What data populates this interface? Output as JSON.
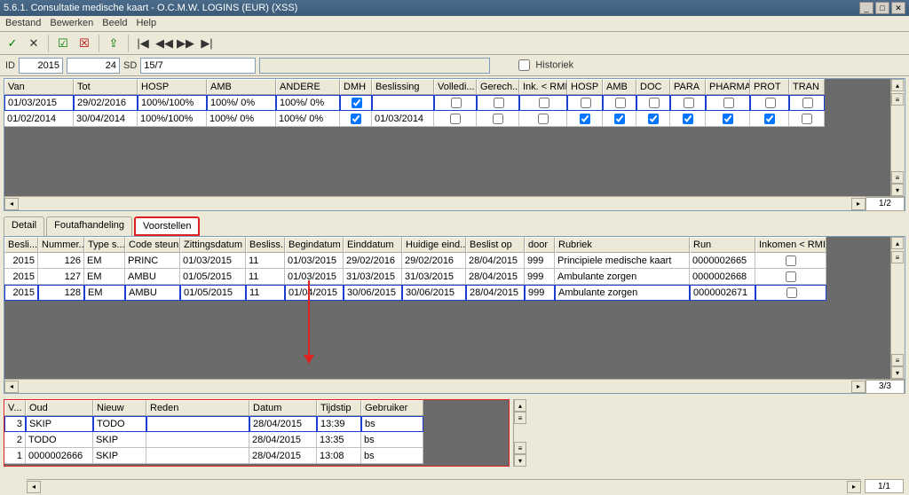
{
  "window": {
    "title": "5.6.1. Consultatie medische kaart - O.C.M.W. LOGINS (EUR) (XSS)",
    "menu": [
      "Bestand",
      "Bewerken",
      "Beeld",
      "Help"
    ]
  },
  "toolbar": {
    "ok": "✓",
    "cancel": "✕",
    "checkbox_on": "☑",
    "checkbox_off": "☒",
    "export": "⇪",
    "first": "|◀",
    "prev": "◀◀",
    "next": "▶▶",
    "last": "▶|"
  },
  "idrow": {
    "id_label": "ID",
    "id_year": "2015",
    "id_num": "24",
    "sd_label": "SD",
    "sd_val": "15/7",
    "hist_label": "Historiek"
  },
  "grid1": {
    "headers": [
      "Van",
      "Tot",
      "HOSP",
      "AMB",
      "ANDERE",
      "DMH",
      "Beslissing",
      "Volledi...",
      "Gerech...",
      "Ink. < RMI",
      "HOSP",
      "AMB",
      "DOC",
      "PARA",
      "PHARMA",
      "PROT",
      "TRAN"
    ],
    "rows": [
      {
        "van": "01/03/2015",
        "tot": "29/02/2016",
        "hosp": "100%/100%",
        "amb": "100%/ 0%",
        "and": "100%/ 0%",
        "dmh": true,
        "bes": "",
        "v": false,
        "g": false,
        "ink": false,
        "h2": false,
        "a2": false,
        "d": false,
        "pa": false,
        "ph": false,
        "pr": false,
        "tr": false,
        "sel": true
      },
      {
        "van": "01/02/2014",
        "tot": "30/04/2014",
        "hosp": "100%/100%",
        "amb": "100%/ 0%",
        "and": "100%/ 0%",
        "dmh": true,
        "bes": "01/03/2014",
        "v": false,
        "g": false,
        "ink": false,
        "h2": true,
        "a2": true,
        "d": true,
        "pa": true,
        "ph": true,
        "pr": true,
        "tr": false
      }
    ],
    "page": "1/2"
  },
  "tabs": {
    "detail": "Detail",
    "fout": "Foutafhandeling",
    "voor": "Voorstellen"
  },
  "grid2": {
    "headers": [
      "Besli...",
      "Nummer...",
      "Type s...",
      "Code steun",
      "Zittingsdatum",
      "Besliss...",
      "Begindatum",
      "Einddatum",
      "Huidige eind...",
      "Beslist op",
      "door",
      "Rubriek",
      "Run",
      "Inkomen < RMI"
    ],
    "rows": [
      {
        "b": "2015",
        "n": "126",
        "t": "EM",
        "c": "PRINC",
        "z": "01/03/2015",
        "bs": "11",
        "bg": "01/03/2015",
        "e": "29/02/2016",
        "h": "29/02/2016",
        "bo": "28/04/2015",
        "d": "999",
        "r": "Principiele medische kaart",
        "run": "0000002665",
        "ink": false
      },
      {
        "b": "2015",
        "n": "127",
        "t": "EM",
        "c": "AMBU",
        "z": "01/05/2015",
        "bs": "11",
        "bg": "01/03/2015",
        "e": "31/03/2015",
        "h": "31/03/2015",
        "bo": "28/04/2015",
        "d": "999",
        "r": "Ambulante zorgen",
        "run": "0000002668",
        "ink": false
      },
      {
        "b": "2015",
        "n": "128",
        "t": "EM",
        "c": "AMBU",
        "z": "01/05/2015",
        "bs": "11",
        "bg": "01/04/2015",
        "e": "30/06/2015",
        "h": "30/06/2015",
        "bo": "28/04/2015",
        "d": "999",
        "r": "Ambulante zorgen",
        "run": "0000002671",
        "ink": false,
        "sel": true
      }
    ],
    "page": "3/3"
  },
  "grid3": {
    "headers": [
      "V...",
      "Oud",
      "Nieuw",
      "Reden",
      "Datum",
      "Tijdstip",
      "Gebruiker"
    ],
    "rows": [
      {
        "v": "3",
        "o": "SKIP",
        "n": "TODO",
        "r": "",
        "d": "28/04/2015",
        "t": "13:39",
        "g": "bs",
        "sel": true
      },
      {
        "v": "2",
        "o": "TODO",
        "n": "SKIP",
        "r": "",
        "d": "28/04/2015",
        "t": "13:35",
        "g": "bs"
      },
      {
        "v": "1",
        "o": "0000002666",
        "n": "SKIP",
        "r": "",
        "d": "28/04/2015",
        "t": "13:08",
        "g": "bs"
      }
    ]
  },
  "footer": {
    "page": "1/1"
  }
}
